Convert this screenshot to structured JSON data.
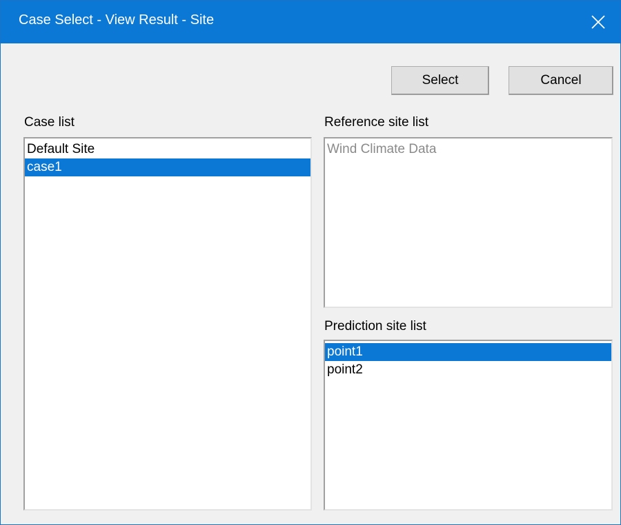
{
  "window": {
    "title": "Case Select - View Result - Site",
    "accent_color": "#0a78d4",
    "close_icon": "close-icon"
  },
  "buttons": {
    "select_label": "Select",
    "cancel_label": "Cancel"
  },
  "case_list": {
    "label": "Case list",
    "items": [
      {
        "label": "Default Site",
        "selected": false
      },
      {
        "label": "case1",
        "selected": true
      }
    ]
  },
  "reference_site_list": {
    "label": "Reference site list",
    "items": [
      {
        "label": "Wind Climate Data",
        "disabled": true
      }
    ]
  },
  "prediction_site_list": {
    "label": "Prediction site list",
    "items": [
      {
        "label": "point1",
        "selected": true
      },
      {
        "label": "point2",
        "selected": false
      }
    ]
  }
}
